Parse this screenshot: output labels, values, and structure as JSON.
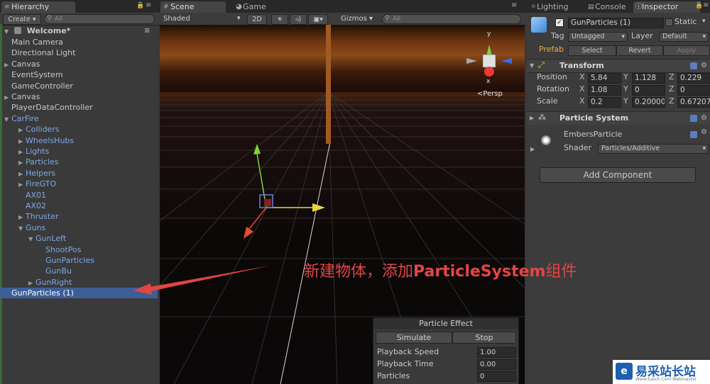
{
  "hierarchy": {
    "tab_label": "Hierarchy",
    "create_label": "Create",
    "search_placeholder": "All",
    "scene_name": "Welcome*",
    "items": [
      {
        "label": "Main Camera",
        "indent": 1,
        "arrow": "",
        "style": ""
      },
      {
        "label": "Directional Light",
        "indent": 1,
        "arrow": "",
        "style": ""
      },
      {
        "label": "Canvas",
        "indent": 1,
        "arrow": "right",
        "style": ""
      },
      {
        "label": "EventSystem",
        "indent": 1,
        "arrow": "",
        "style": ""
      },
      {
        "label": "GameController",
        "indent": 1,
        "arrow": "",
        "style": ""
      },
      {
        "label": "Canvas",
        "indent": 1,
        "arrow": "right",
        "style": ""
      },
      {
        "label": "PlayerDataController",
        "indent": 1,
        "arrow": "",
        "style": ""
      },
      {
        "label": "CarFire",
        "indent": 1,
        "arrow": "down",
        "style": "blue"
      },
      {
        "label": "Colliders",
        "indent": 2,
        "arrow": "right",
        "style": "blue"
      },
      {
        "label": "WheelsHubs",
        "indent": 2,
        "arrow": "right",
        "style": "blue"
      },
      {
        "label": "Lights",
        "indent": 2,
        "arrow": "right",
        "style": "blue"
      },
      {
        "label": "Particles",
        "indent": 2,
        "arrow": "right",
        "style": "blue"
      },
      {
        "label": "Helpers",
        "indent": 2,
        "arrow": "right",
        "style": "blue"
      },
      {
        "label": "FireGTO",
        "indent": 2,
        "arrow": "right",
        "style": "blue"
      },
      {
        "label": "AX01",
        "indent": 2,
        "arrow": "",
        "style": "blue"
      },
      {
        "label": "AX02",
        "indent": 2,
        "arrow": "",
        "style": "blue"
      },
      {
        "label": "Thruster",
        "indent": 2,
        "arrow": "right",
        "style": "blue"
      },
      {
        "label": "Guns",
        "indent": 2,
        "arrow": "down",
        "style": "blue"
      },
      {
        "label": "GunLeft",
        "indent": 3,
        "arrow": "down",
        "style": "blue"
      },
      {
        "label": "ShootPos",
        "indent": 4,
        "arrow": "",
        "style": "blue"
      },
      {
        "label": "GunParticles",
        "indent": 4,
        "arrow": "",
        "style": "blue"
      },
      {
        "label": "GunBu",
        "indent": 4,
        "arrow": "",
        "style": "blue"
      },
      {
        "label": "GunRight",
        "indent": 3,
        "arrow": "right",
        "style": "blue"
      },
      {
        "label": "GunParticles (1)",
        "indent": 1,
        "arrow": "",
        "style": "sel"
      }
    ]
  },
  "scene": {
    "tabs": [
      "Scene",
      "Game"
    ],
    "shading_mode": "Shaded",
    "mode_2d": "2D",
    "gizmos_label": "Gizmos",
    "search_placeholder": "All",
    "persp_label": "Persp",
    "gizmo_axes": {
      "y": "y",
      "x": "x"
    }
  },
  "particle_effect": {
    "title": "Particle Effect",
    "simulate": "Simulate",
    "stop": "Stop",
    "rows": [
      {
        "label": "Playback Speed",
        "value": "1.00"
      },
      {
        "label": "Playback Time",
        "value": "0.00"
      },
      {
        "label": "Particles",
        "value": "0"
      }
    ]
  },
  "inspector": {
    "tabs": [
      "Lighting",
      "Console",
      "Inspector"
    ],
    "object_name": "GunParticles (1)",
    "static_label": "Static",
    "tag_label": "Tag",
    "tag_value": "Untagged",
    "layer_label": "Layer",
    "layer_value": "Default",
    "prefab_label": "Prefab",
    "prefab_select": "Select",
    "prefab_revert": "Revert",
    "prefab_apply": "Apply",
    "transform": {
      "title": "Transform",
      "rows": [
        {
          "label": "Position",
          "x": "5.84",
          "y": "1.128",
          "z": "0.229"
        },
        {
          "label": "Rotation",
          "x": "1.08",
          "y": "0",
          "z": "0"
        },
        {
          "label": "Scale",
          "x": "0.2",
          "y": "0.20000",
          "z": "0.67207"
        }
      ],
      "axis_labels": [
        "X",
        "Y",
        "Z"
      ]
    },
    "particle_system_title": "Particle System",
    "material": {
      "name": "EmbersParticle",
      "shader_label": "Shader",
      "shader_value": "Particles/Additive"
    },
    "add_component": "Add Component"
  },
  "annotation": {
    "text_cn": "新建物体，添加",
    "text_bold": "ParticleSystem",
    "text_tail": "组件"
  },
  "watermark": {
    "cn": "易采站长站",
    "en": "Www.Easck.Com Webmaster"
  },
  "colors": {
    "selection": "#3d5f97",
    "prefab_blue": "#7ea8e8",
    "annotation_red": "#e14646",
    "accent_green": "#3b8f3b"
  }
}
